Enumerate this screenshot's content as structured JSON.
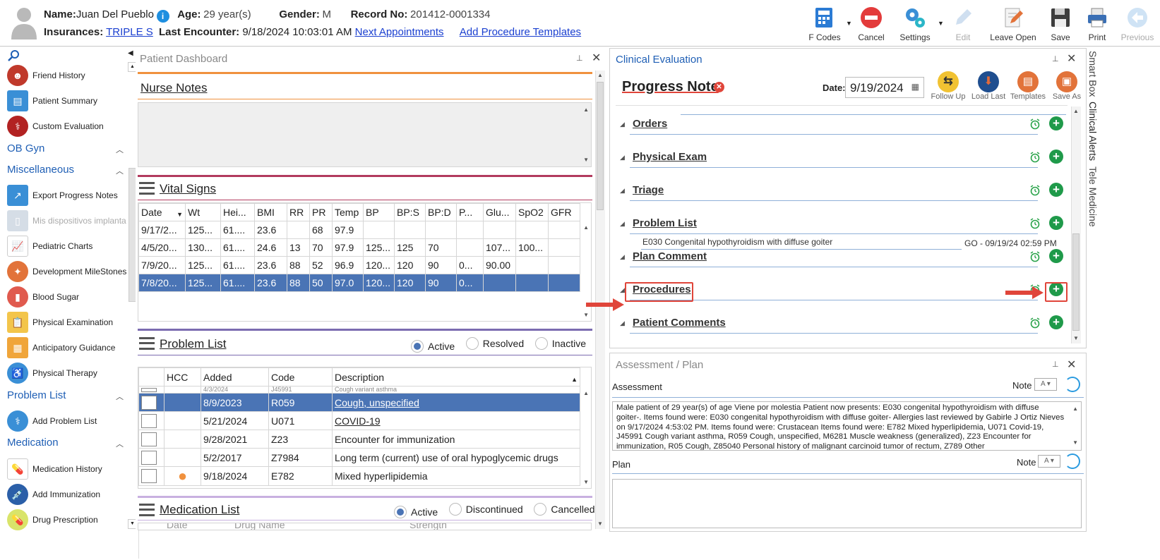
{
  "header": {
    "name_label": "Name:",
    "name": "Juan Del Pueblo",
    "age_label": "Age:",
    "age": "29 year(s)",
    "gender_label": "Gender:",
    "gender": "M",
    "record_label": "Record No:",
    "record": "201412-0001334",
    "insurances_label": "Insurances:",
    "insurance": "TRIPLE S",
    "last_enc_label": "Last Encounter:",
    "last_enc": "9/18/2024 10:03:01 AM",
    "next_appt": "Next Appointments",
    "add_proc_templates": "Add Procedure Templates"
  },
  "toolbar": {
    "fcodes": "F Codes",
    "cancel": "Cancel",
    "settings": "Settings",
    "edit": "Edit",
    "leave_open": "Leave Open",
    "save": "Save",
    "print": "Print",
    "previous": "Previous"
  },
  "sidebar": {
    "items": [
      {
        "label": "Friend History",
        "color": "#c0392b"
      },
      {
        "label": "Patient Summary",
        "color": "#3a8fd6"
      },
      {
        "label": "Custom Evaluation",
        "color": "#b22222"
      }
    ],
    "sections": {
      "obgyn": "OB Gyn",
      "misc": "Miscellaneous",
      "problem": "Problem List",
      "medication": "Medication"
    },
    "misc_items": [
      "Export Progress Notes",
      "Mis dispositivos implanta",
      "Pediatric Charts",
      "Development MileStones",
      "Blood Sugar",
      "Physical Examination",
      "Anticipatory Guidance",
      "Physical Therapy"
    ],
    "problem_items": [
      "Add Problem List"
    ],
    "med_items": [
      "Medication History",
      "Add Immunization",
      "Drug Prescription"
    ]
  },
  "dashboard": {
    "title": "Patient Dashboard",
    "nurse_notes": "Nurse Notes",
    "vital_signs": "Vital Signs",
    "vital_cols": [
      "Date",
      "Wt",
      "Hei...",
      "BMI",
      "RR",
      "PR",
      "Temp",
      "BP",
      "BP:S",
      "BP:D",
      "P...",
      "Glu...",
      "SpO2",
      "GFR"
    ],
    "vital_rows": [
      [
        "9/17/2...",
        "125...",
        "61....",
        "23.6",
        "",
        "68",
        "97.9",
        "",
        "",
        "",
        "",
        "",
        "",
        ""
      ],
      [
        "4/5/20...",
        "130...",
        "61....",
        "24.6",
        "13",
        "70",
        "97.9",
        "125...",
        "125",
        "70",
        "",
        "107...",
        "100...",
        ""
      ],
      [
        "7/9/20...",
        "125...",
        "61....",
        "23.6",
        "88",
        "52",
        "96.9",
        "120...",
        "120",
        "90",
        "0...",
        "90.00",
        "",
        ""
      ],
      [
        "7/8/20...",
        "125...",
        "61....",
        "23.6",
        "88",
        "50",
        "97.0",
        "120...",
        "120",
        "90",
        "0...",
        "",
        "",
        ""
      ]
    ],
    "problem_list": "Problem List",
    "pl_active": "Active",
    "pl_resolved": "Resolved",
    "pl_inactive": "Inactive",
    "pl_cols": [
      "",
      "HCC",
      "Added",
      "Code",
      "Description"
    ],
    "pl_rows": [
      [
        "",
        "",
        "4/3/2024",
        "J45991",
        "Cough variant asthma"
      ],
      [
        "",
        "",
        "8/9/2023",
        "R059",
        "Cough, unspecified"
      ],
      [
        "",
        "",
        "5/21/2024",
        "U071",
        "COVID-19"
      ],
      [
        "",
        "",
        "9/28/2021",
        "Z23",
        "Encounter for immunization"
      ],
      [
        "",
        "",
        "5/2/2017",
        "Z7984",
        "Long term (current) use of oral hypoglycemic drugs"
      ],
      [
        "",
        "●",
        "9/18/2024",
        "E782",
        "Mixed hyperlipidemia"
      ]
    ],
    "medication_list": "Medication List",
    "ml_active": "Active",
    "ml_discontinued": "Discontinued",
    "ml_cancelled": "Cancelled",
    "ml_cols": [
      "Date",
      "Drug Name",
      "Strength"
    ]
  },
  "clinical": {
    "title": "Clinical Evaluation",
    "note_title": "Progress Note",
    "date_label": "Date:",
    "date": "9/19/2024",
    "follow_up": "Follow Up",
    "load_last": "Load Last",
    "templates": "Templates",
    "save_as": "Save As",
    "sections": [
      "Orders",
      "Physical Exam",
      "Triage",
      "Problem List",
      "Plan Comment",
      "Procedures",
      "Patient Comments"
    ],
    "problem_entry": "E030 Congenital hypothyroidism with diffuse goiter",
    "problem_meta": "GO - 09/19/24 02:59 PM"
  },
  "assessment": {
    "title": "Assessment / Plan",
    "assessment_label": "Assessment",
    "note": "Note",
    "plan_label": "Plan",
    "text": "Male patient of 29 year(s) of age Viene por molestia Patient now presents: E030 congenital hypothyroidism with diffuse goiter-. Items found were: E030 congenital hypothyroidism with diffuse goiter-   Allergies last reviewed by Gabirle J Ortiz Nieves on 9/17/2024 4:53:02 PM.    Items found were:  Crustacean  Items found were:  E782 Mixed hyperlipidemia, U071 Covid-19, J45991 Cough variant asthma, R059 Cough, unspecified, M6281 Muscle weakness (generalized), Z23 Encounter for immunization, R05 Cough, Z85040 Personal history of malignant carcinoid tumor of rectum, Z789 Other"
  },
  "side_tabs": [
    "Smart Box",
    "Clinical Alerts",
    "Tele Medicine"
  ]
}
